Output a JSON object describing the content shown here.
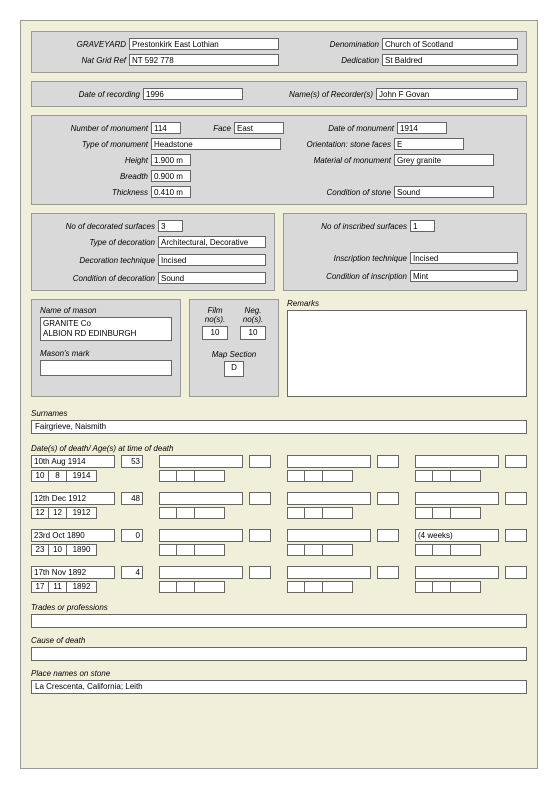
{
  "header": {
    "graveyard_label": "GRAVEYARD",
    "graveyard": "Prestonkirk East Lothian",
    "denomination_label": "Denomination",
    "denomination": "Church of Scotland",
    "natgrid_label": "Nat Grid Ref",
    "natgrid": "NT 592 778",
    "dedication_label": "Dedication",
    "dedication": "St Baldred"
  },
  "recording": {
    "date_label": "Date of recording",
    "date": "1996",
    "recorder_label": "Name(s) of Recorder(s)",
    "recorder": "John F Govan"
  },
  "monument": {
    "number_label": "Number of monument",
    "number": "114",
    "face_label": "Face",
    "face": "East",
    "date_label": "Date of monument",
    "date": "1914",
    "type_label": "Type of monument",
    "type": "Headstone",
    "orientation_label": "Orientation: stone faces",
    "orientation": "E",
    "height_label": "Height",
    "height": "1.900 m",
    "material_label": "Material of monument",
    "material": "Grey granite",
    "breadth_label": "Breadth",
    "breadth": "0.900 m",
    "thickness_label": "Thickness",
    "thickness": "0.410 m",
    "condition_label": "Condition of stone",
    "condition": "Sound"
  },
  "dec": {
    "surfaces_label": "No of decorated surfaces",
    "surfaces": "3",
    "type_label": "Type of decoration",
    "type": "Architectural, Decorative",
    "technique_label": "Decoration technique",
    "technique": "Incised",
    "condition_label": "Condition of decoration",
    "condition": "Sound"
  },
  "ins": {
    "surfaces_label": "No of inscribed surfaces",
    "surfaces": "1",
    "technique_label": "Inscription technique",
    "technique": "Incised",
    "condition_label": "Condition of inscription",
    "condition": "Mint"
  },
  "mason": {
    "name_label": "Name of mason",
    "name": "GRANITE Co\nALBION RD EDINBURGH",
    "mark_label": "Mason's mark"
  },
  "film": {
    "film_label": "Film no(s).",
    "film": "10",
    "neg_label": "Neg. no(s).",
    "neg": "10",
    "map_label": "Map Section",
    "map": "D"
  },
  "remarks_label": "Remarks",
  "surnames_label": "Surnames",
  "surnames": "Fairgrieve, Naismith",
  "dates_label": "Date(s) of death/ Age(s) at time of death",
  "deaths": [
    [
      {
        "date": "10th Aug 1914",
        "age": "53",
        "d": "10",
        "m": "8",
        "y": "1914"
      },
      {
        "date": "",
        "age": "",
        "d": "",
        "m": "",
        "y": ""
      },
      {
        "date": "",
        "age": "",
        "d": "",
        "m": "",
        "y": ""
      },
      {
        "date": "",
        "age": "",
        "d": "",
        "m": "",
        "y": ""
      }
    ],
    [
      {
        "date": "12th Dec 1912",
        "age": "48",
        "d": "12",
        "m": "12",
        "y": "1912"
      },
      {
        "date": "",
        "age": "",
        "d": "",
        "m": "",
        "y": ""
      },
      {
        "date": "",
        "age": "",
        "d": "",
        "m": "",
        "y": ""
      },
      {
        "date": "",
        "age": "",
        "d": "",
        "m": "",
        "y": ""
      }
    ],
    [
      {
        "date": "23rd Oct 1890",
        "age": "0",
        "d": "23",
        "m": "10",
        "y": "1890"
      },
      {
        "date": "",
        "age": "",
        "d": "",
        "m": "",
        "y": ""
      },
      {
        "date": "",
        "age": "",
        "d": "",
        "m": "",
        "y": ""
      },
      {
        "date": "(4 weeks)",
        "age": "",
        "d": "",
        "m": "",
        "y": ""
      }
    ],
    [
      {
        "date": "17th Nov 1892",
        "age": "4",
        "d": "17",
        "m": "11",
        "y": "1892"
      },
      {
        "date": "",
        "age": "",
        "d": "",
        "m": "",
        "y": ""
      },
      {
        "date": "",
        "age": "",
        "d": "",
        "m": "",
        "y": ""
      },
      {
        "date": "",
        "age": "",
        "d": "",
        "m": "",
        "y": ""
      }
    ]
  ],
  "trades_label": "Trades or professions",
  "trades": "",
  "cause_label": "Cause of death",
  "cause": "",
  "places_label": "Place names on stone",
  "places": "La Crescenta, California; Leith"
}
